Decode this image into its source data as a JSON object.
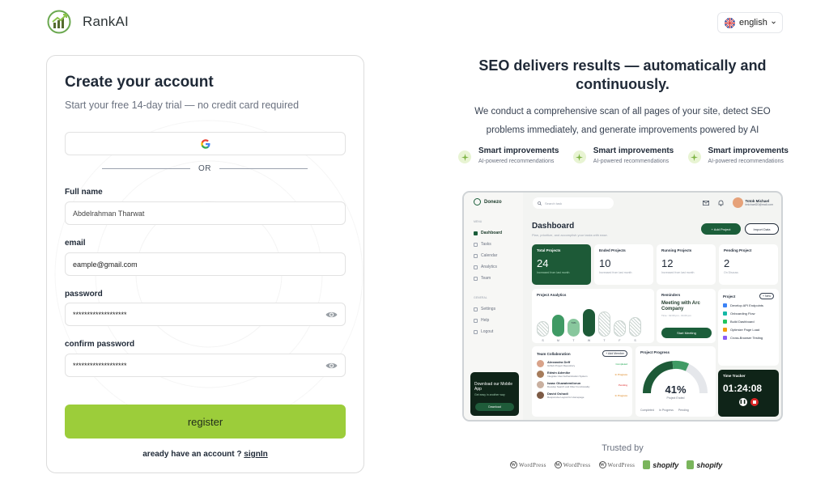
{
  "header": {
    "brand": "RankAI",
    "language": {
      "selected": "english"
    }
  },
  "signup": {
    "title": "Create your account",
    "subtitle": "Start your free 14-day trial — no credit card required",
    "divider": "OR",
    "fields": {
      "fullname": {
        "label": "Full name",
        "value": "Abdelrahman Tharwat"
      },
      "email": {
        "label": "email",
        "value": "eample@gmail.com"
      },
      "password": {
        "label": "password",
        "value": "*******************"
      },
      "confirm": {
        "label": "confirm password",
        "value": "*******************"
      }
    },
    "register_label": "register",
    "have_account": "aready have an account ?",
    "signin_link": "signIn"
  },
  "promo": {
    "headline": "SEO delivers results — automatically and continuously.",
    "description": "We conduct a comprehensive scan of all pages of your site, detect SEO problems immediately, and generate improvements powered by AI",
    "features": [
      {
        "title": "Smart improvements",
        "subtitle": "AI-powered recommendations"
      },
      {
        "title": "Smart improvements",
        "subtitle": "AI-powered recommendations"
      },
      {
        "title": "Smart improvements",
        "subtitle": "AI-powered recommendations"
      }
    ]
  },
  "dashboard_preview": {
    "brand": "Donezo",
    "search_placeholder": "Search task",
    "user": {
      "name": "Totok Michael",
      "email": "tmichael20@mail.com"
    },
    "menu_header": "MENU",
    "general_header": "GENERAL",
    "menu": [
      "Dashboard",
      "Tasks",
      "Calendar",
      "Analytics",
      "Team"
    ],
    "general": [
      "Settings",
      "Help",
      "Logout"
    ],
    "title": "Dashboard",
    "subtitle": "Plan, prioritize, and accomplish your tasks with ease.",
    "add_project": "+ Add Project",
    "import_data": "Import Data",
    "stats": [
      {
        "title": "Total Projects",
        "value": "24",
        "note": "Increased from last month"
      },
      {
        "title": "Ended Projects",
        "value": "10",
        "note": "Increased from last month"
      },
      {
        "title": "Running Projects",
        "value": "12",
        "note": "Increased from last month"
      },
      {
        "title": "Pending Project",
        "value": "2",
        "note": "On Discuss"
      }
    ],
    "analytics_title": "Project Analytics",
    "analytics_days": [
      "S",
      "M",
      "T",
      "W",
      "T",
      "F",
      "S"
    ],
    "analytics_values": [
      0.55,
      0.8,
      0.65,
      1.0,
      0.9,
      0.6,
      0.7
    ],
    "analytics_peak": "74%",
    "reminders_title": "Reminders",
    "reminder_text": "Meeting with Arc Company",
    "reminder_time": "Time : 02.00 pm - 04.00 pm",
    "start_meeting": "Start Meeting",
    "project_title": "Project",
    "project_new": "+ New",
    "projects": [
      {
        "name": "Develop API Endpoints",
        "color": "#3b82f6"
      },
      {
        "name": "Onboarding Flow",
        "color": "#14b8a6"
      },
      {
        "name": "Build Dashboard",
        "color": "#22c55e"
      },
      {
        "name": "Optimize Page Load",
        "color": "#f59e0b"
      },
      {
        "name": "Cross-Browser Testing",
        "color": "#8b5cf6"
      }
    ],
    "team_title": "Team Collaboration",
    "add_member": "+ Add Member",
    "members": [
      {
        "name": "Alexandra Deff",
        "task": "Github Project Repository",
        "status": "Completed",
        "color": "#d9a38a"
      },
      {
        "name": "Edwin Adenike",
        "task": "Integrate User Authentication System",
        "status": "In Progress",
        "color": "#a67c5b"
      },
      {
        "name": "Isaac Oluwatemilorun",
        "task": "Develop Search and Filter Functionality",
        "status": "Pending",
        "color": "#c9b0a0"
      },
      {
        "name": "David Oshodi",
        "task": "Responsive Layout for Homepage",
        "status": "In Progress",
        "color": "#7c5a45"
      }
    ],
    "progress_title": "Project Progress",
    "progress_value": "41%",
    "progress_label": "Project Ended",
    "progress_legend": [
      "Completed",
      "In Progress",
      "Pending"
    ],
    "mobile_title": "Download our Mobile App",
    "mobile_sub": "Get easy in another way",
    "mobile_btn": "Download",
    "timer_title": "Time Tracker",
    "timer_value": "01:24:08"
  },
  "trusted": {
    "label": "Trusted by",
    "logos": [
      "WordPress",
      "WordPress",
      "WordPress",
      "shopify",
      "shopify"
    ]
  },
  "colors": {
    "accent": "#9ccd3a",
    "dark_green": "#1d5a37"
  }
}
